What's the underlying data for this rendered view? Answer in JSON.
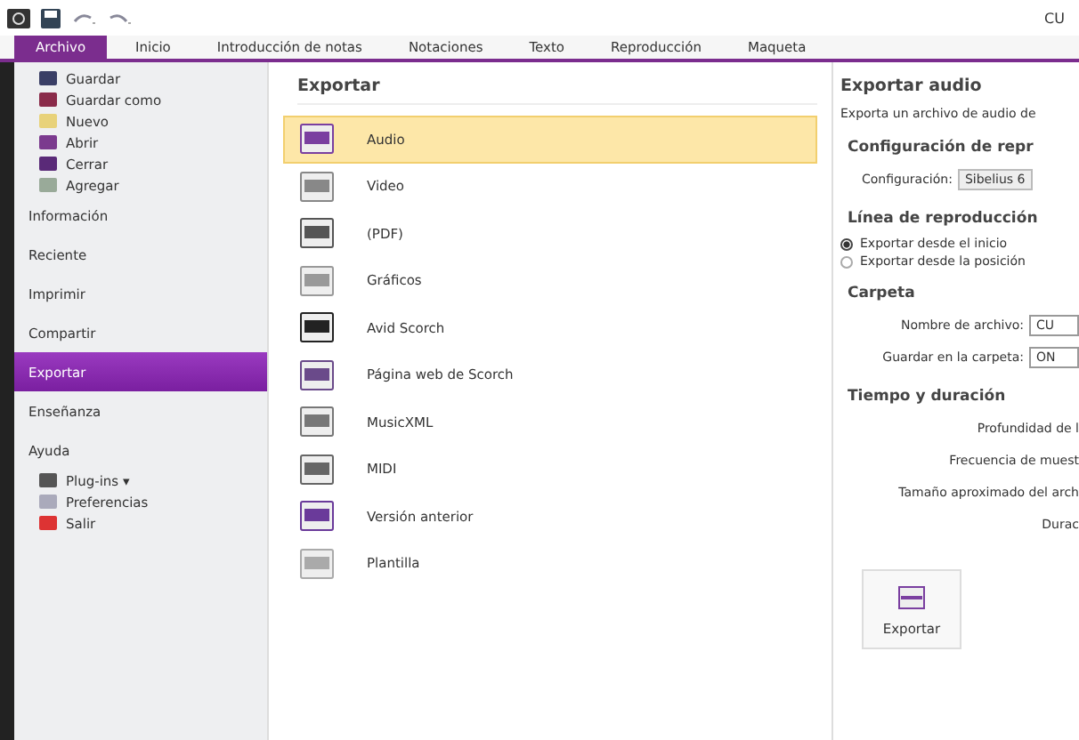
{
  "window": {
    "title": "CU"
  },
  "tabs": [
    {
      "label": "Archivo",
      "selected": true
    },
    {
      "label": "Inicio",
      "selected": false
    },
    {
      "label": "Introducción de notas",
      "selected": false
    },
    {
      "label": "Notaciones",
      "selected": false
    },
    {
      "label": "Texto",
      "selected": false
    },
    {
      "label": "Reproducción",
      "selected": false
    },
    {
      "label": "Maqueta",
      "selected": false
    }
  ],
  "sidebar": {
    "items": [
      {
        "label": "Guardar",
        "kind": "command",
        "selected": false
      },
      {
        "label": "Guardar como",
        "kind": "command",
        "selected": false
      },
      {
        "label": "Nuevo",
        "kind": "command",
        "selected": false
      },
      {
        "label": "Abrir",
        "kind": "command",
        "selected": false
      },
      {
        "label": "Cerrar",
        "kind": "command",
        "selected": false
      },
      {
        "label": "Agregar",
        "kind": "command",
        "selected": false
      },
      {
        "label": "Información",
        "kind": "section",
        "selected": false
      },
      {
        "label": "Reciente",
        "kind": "section",
        "selected": false
      },
      {
        "label": "Imprimir",
        "kind": "section",
        "selected": false
      },
      {
        "label": "Compartir",
        "kind": "section",
        "selected": false
      },
      {
        "label": "Exportar",
        "kind": "section",
        "selected": true
      },
      {
        "label": "Enseñanza",
        "kind": "section",
        "selected": false
      },
      {
        "label": "Ayuda",
        "kind": "section",
        "selected": false
      },
      {
        "label": "Plug-ins ▾",
        "kind": "command",
        "selected": false
      },
      {
        "label": "Preferencias",
        "kind": "command",
        "selected": false
      },
      {
        "label": "Salir",
        "kind": "command",
        "selected": false
      }
    ]
  },
  "export_list": {
    "title": "Exportar",
    "items": [
      {
        "label": "Audio",
        "selected": true
      },
      {
        "label": "Video",
        "selected": false
      },
      {
        "label": "(PDF)",
        "selected": false
      },
      {
        "label": "Gráficos",
        "selected": false
      },
      {
        "label": "Avid Scorch",
        "selected": false
      },
      {
        "label": "Página web de Scorch",
        "selected": false
      },
      {
        "label": "MusicXML",
        "selected": false
      },
      {
        "label": "MIDI",
        "selected": false
      },
      {
        "label": "Versión anterior",
        "selected": false
      },
      {
        "label": "Plantilla",
        "selected": false
      }
    ]
  },
  "export_pane": {
    "title": "Exportar audio",
    "description": "Exporta un archivo de audio de",
    "playback_config": {
      "heading": "Configuración de repr",
      "label": "Configuración:",
      "value": "Sibelius 6"
    },
    "playback_line": {
      "heading": "Línea de reproducción",
      "options": [
        {
          "label": "Exportar desde el inicio",
          "selected": true
        },
        {
          "label": "Exportar desde la posición",
          "selected": false
        }
      ]
    },
    "folder": {
      "heading": "Carpeta",
      "fields": [
        {
          "label": "Nombre de archivo:",
          "value": "CU"
        },
        {
          "label": "Guardar en la carpeta:",
          "value": "ON"
        }
      ]
    },
    "timing": {
      "heading": "Tiempo y duración",
      "rows": [
        "Profundidad de l",
        "Frecuencia de muest",
        "Tamaño aproximado del arch",
        "Durac"
      ]
    },
    "button": "Exportar"
  }
}
